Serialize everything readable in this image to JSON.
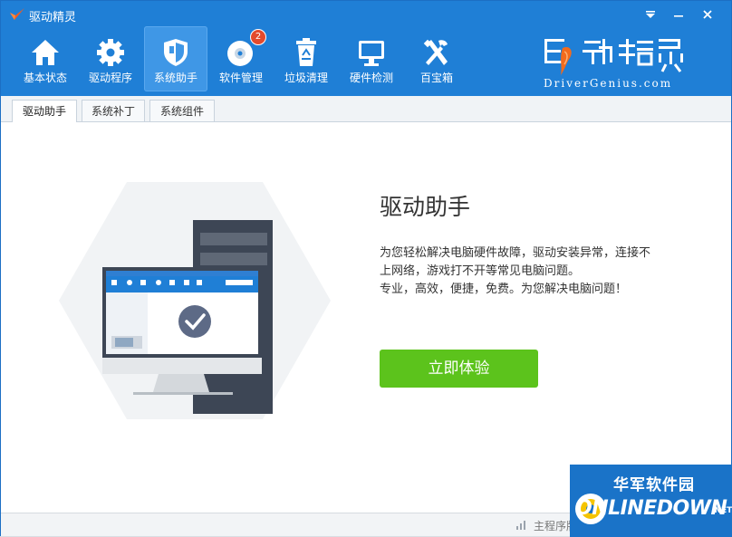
{
  "window": {
    "title": "驱动精灵"
  },
  "toolbar": {
    "items": [
      {
        "label": "基本状态",
        "icon": "home-icon"
      },
      {
        "label": "驱动程序",
        "icon": "gear-icon"
      },
      {
        "label": "系统助手",
        "icon": "shield-icon",
        "active": true
      },
      {
        "label": "软件管理",
        "icon": "disc-icon",
        "badge": "2"
      },
      {
        "label": "垃圾清理",
        "icon": "recycle-bin-icon"
      },
      {
        "label": "硬件检测",
        "icon": "monitor-icon"
      },
      {
        "label": "百宝箱",
        "icon": "tools-icon"
      }
    ]
  },
  "brand": {
    "subtitle": "DriverGenius.com"
  },
  "subtabs": [
    {
      "label": "驱动助手",
      "active": true
    },
    {
      "label": "系统补丁"
    },
    {
      "label": "系统组件"
    }
  ],
  "feature": {
    "title": "驱动助手",
    "desc_lines": [
      "为您轻松解决电脑硬件故障，驱动安装异常，连接不",
      "上网络，游戏打不开等常见电脑问题。",
      "专业，高效，便捷，免费。为您解决电脑问题！"
    ],
    "cta_label": "立即体验"
  },
  "statusbar": {
    "text": "主程序版"
  },
  "watermark": {
    "title": "华军软件园",
    "brand": "ONLINEDOWN",
    "suffix": ".NET"
  },
  "colors": {
    "header_blue": "#1f7fd6",
    "active_tab": "#3f97e6",
    "cta_green": "#5cc31c",
    "badge_red": "#e34a2c"
  }
}
